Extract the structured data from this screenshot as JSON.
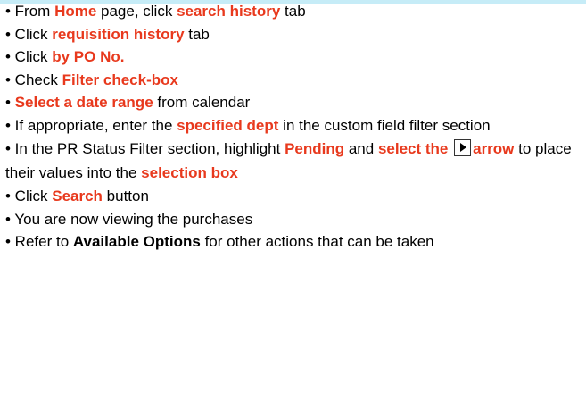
{
  "bullet": "•",
  "highlight_color": "#e8391d",
  "top_strip_color": "#c6ecf7",
  "steps": [
    {
      "p1": " From ",
      "h1": "Home",
      "p2": " page, click ",
      "h2": "search history",
      "p3": " tab"
    },
    {
      "p1": " Click ",
      "h1": "requisition history",
      "p2": " tab"
    },
    {
      "p1": " Click ",
      "h1": "by PO No."
    },
    {
      "p1": " Check ",
      "h1": "Filter check-box"
    },
    {
      "p1": " ",
      "h1": "Select a date range",
      "p2": " from calendar"
    },
    {
      "p1": " If appropriate, enter the ",
      "h1": "specified dept",
      "p2": " in the custom field filter section"
    },
    {
      "p1": " In the PR Status Filter section, highlight ",
      "h1": "Pending",
      "p2": " and ",
      "h2": "select the",
      "icon": "right-arrow-button-icon",
      "h3": "arrow",
      "p3": " to place their values into the ",
      "h4": "selection box"
    },
    {
      "p1": " Click ",
      "h1": "Search",
      "p2": " button"
    },
    {
      "p1": " You are now viewing the purchases"
    },
    {
      "p1": " Refer to ",
      "b1": "Available Options",
      "p2": " for other actions that can be taken"
    }
  ]
}
